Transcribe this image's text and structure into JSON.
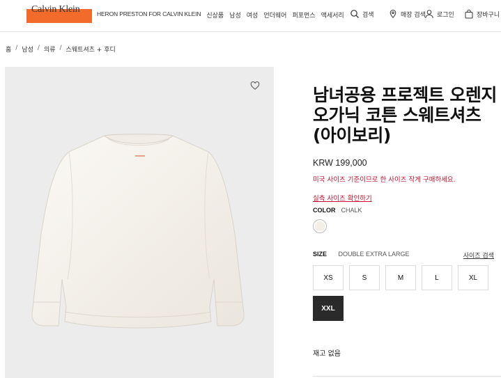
{
  "header": {
    "logo": "Calvin Klein",
    "nav": [
      "HERON PRESTON FOR CALVIN KLEIN",
      "신상품",
      "남성",
      "여성",
      "언더웨어",
      "퍼포먼스",
      "액세서리"
    ],
    "search_label": "검색",
    "store_label": "매장 검색",
    "login_label": "로그인",
    "cart_label": "장바구니",
    "brand_color": "#f26b2b"
  },
  "breadcrumb": [
    "홈",
    "남성",
    "의류",
    "스웨트셔츠 + 후디"
  ],
  "product": {
    "title": "남녀공용 프로젝트 오렌지 오가닉 코튼 스웨트셔츠(아이보리)",
    "price": "KRW 199,000",
    "warning": "미국 사이즈 기준이므로 한 사이즈 작게 구매하세요.",
    "size_check_link": "실측 사이즈 확인하기",
    "color_label": "COLOR",
    "color_value": "CHALK",
    "swatch_color": "#f3eee6",
    "size_label": "SIZE",
    "size_value": "DOUBLE EXTRA LARGE",
    "size_guide": "사이즈 검색",
    "sizes": [
      "XS",
      "S",
      "M",
      "L",
      "XL",
      "XXL"
    ],
    "selected_size": "XXL",
    "stock_status": "재고 없음"
  }
}
